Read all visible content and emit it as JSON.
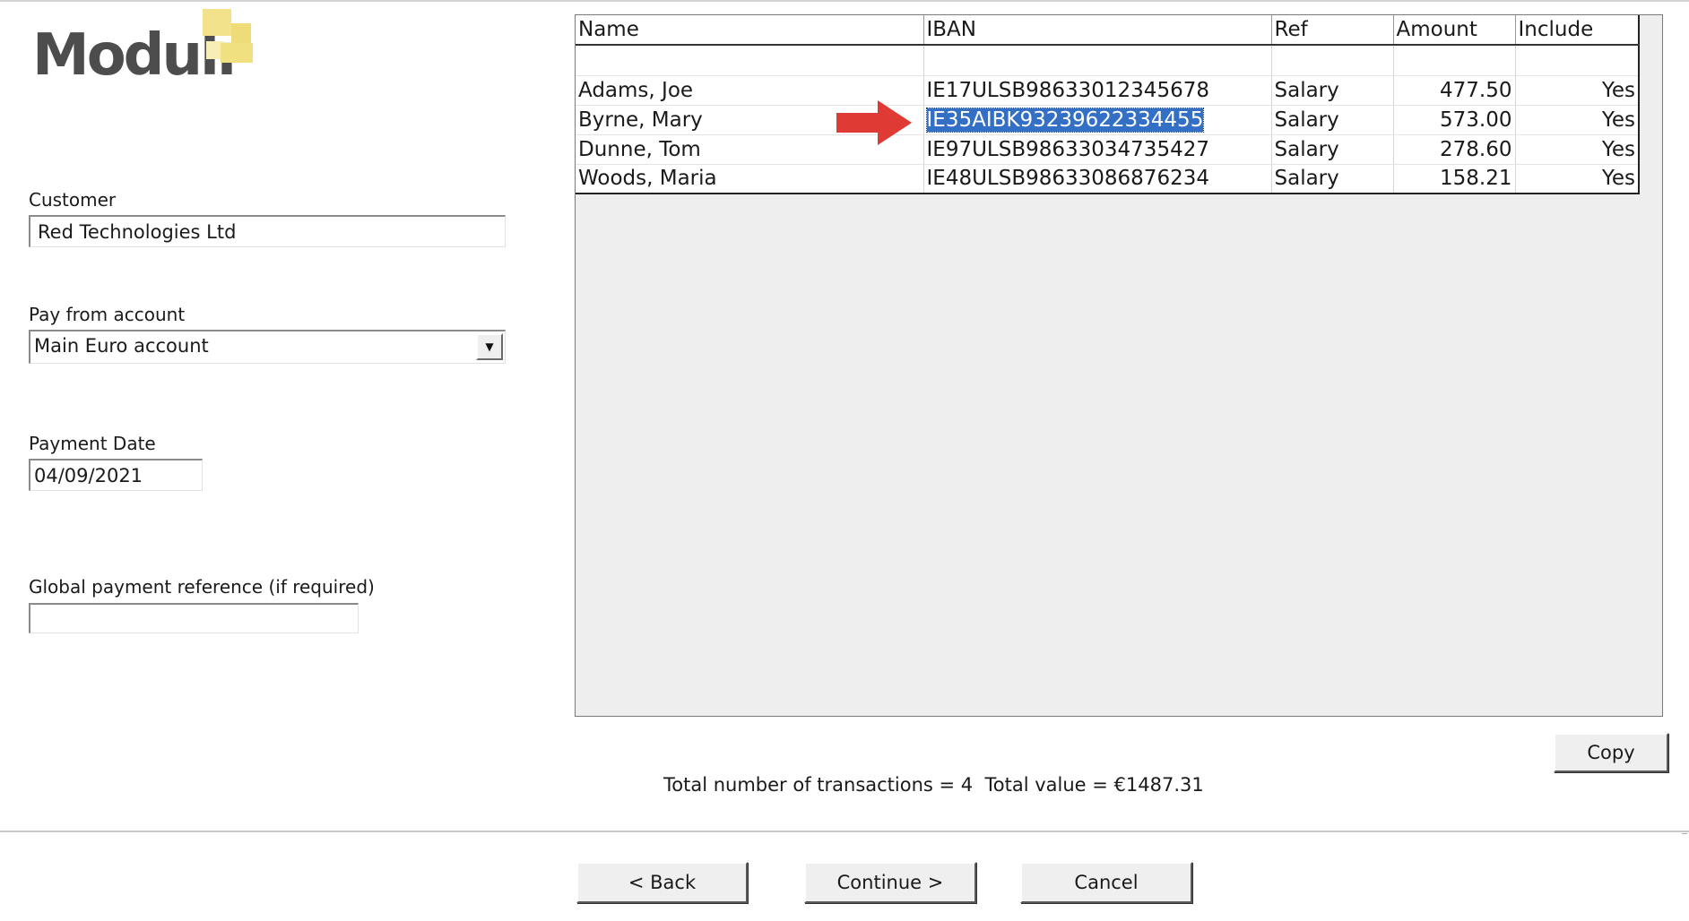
{
  "logo": {
    "text": "Modulr",
    "accent_color": "#f0e080"
  },
  "form": {
    "customer": {
      "label": "Customer",
      "value": "Red Technologies Ltd"
    },
    "pay_from_account": {
      "label": "Pay from account",
      "value": "Main Euro account"
    },
    "payment_date": {
      "label": "Payment Date",
      "value": "04/09/2021"
    },
    "global_reference": {
      "label": "Global payment reference (if required)",
      "value": ""
    }
  },
  "grid": {
    "columns": [
      "Name",
      "IBAN",
      "Ref",
      "Amount",
      "Include"
    ],
    "rows": [
      {
        "name": "Adams, Joe",
        "iban": "IE17ULSB98633012345678",
        "ref": "Salary",
        "amount": "477.50",
        "include": "Yes"
      },
      {
        "name": "Byrne, Mary",
        "iban": "IE35AIBK93239622334455",
        "ref": "Salary",
        "amount": "573.00",
        "include": "Yes"
      },
      {
        "name": "Dunne, Tom",
        "iban": "IE97ULSB98633034735427",
        "ref": "Salary",
        "amount": "278.60",
        "include": "Yes"
      },
      {
        "name": "Woods, Maria",
        "iban": "IE48ULSB98633086876234",
        "ref": "Salary",
        "amount": "158.21",
        "include": "Yes"
      }
    ],
    "selected_cell": {
      "row": 1,
      "column": "iban"
    },
    "highlight_color": "#3370c5",
    "arrow_color": "#e03a34"
  },
  "copy_button": "Copy",
  "totals": {
    "text": "Total number of transactions = 4  Total value = €1487.31"
  },
  "buttons": {
    "back": "< Back",
    "continue": "Continue >",
    "cancel": "Cancel"
  }
}
